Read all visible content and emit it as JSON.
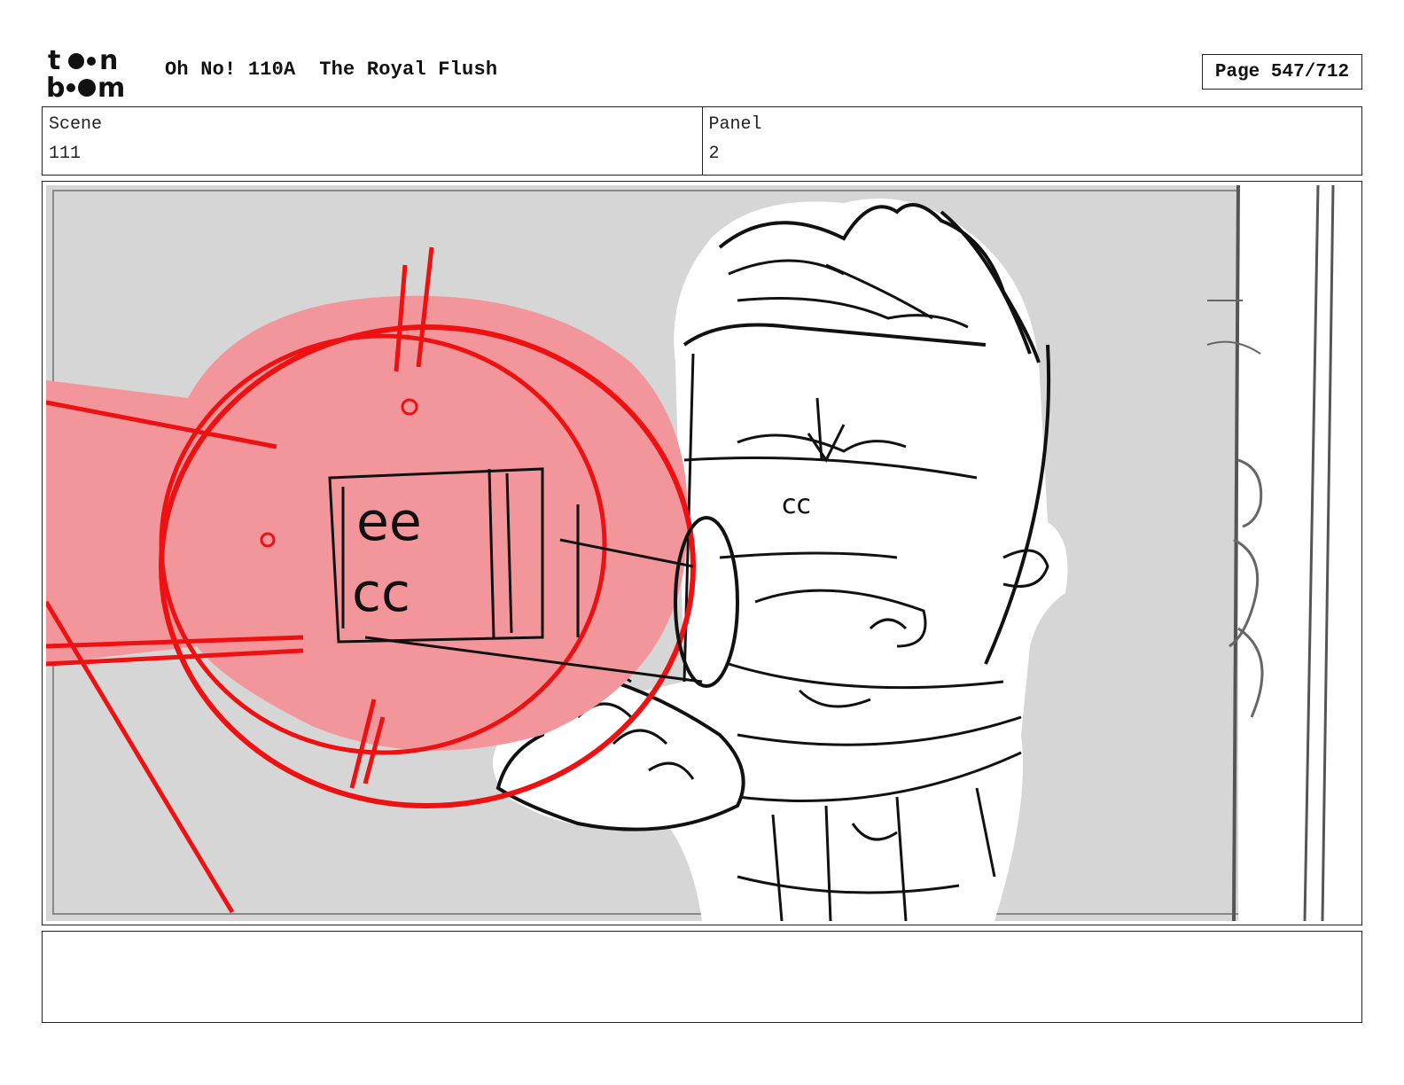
{
  "header": {
    "logo_text": "toon boom",
    "show_title": "Oh No! 110A  The Royal Flush",
    "page_indicator": "Page 547/712"
  },
  "info": {
    "scene_label": "Scene",
    "scene_value": "111",
    "panel_label": "Panel",
    "panel_value": "2"
  },
  "panel_image": {
    "description": "",
    "colors": {
      "background": "#d6d6d6",
      "red_lines": "#ee1111",
      "red_fill": "#f2969b",
      "ink": "#111111"
    }
  },
  "notes": {
    "text": ""
  }
}
